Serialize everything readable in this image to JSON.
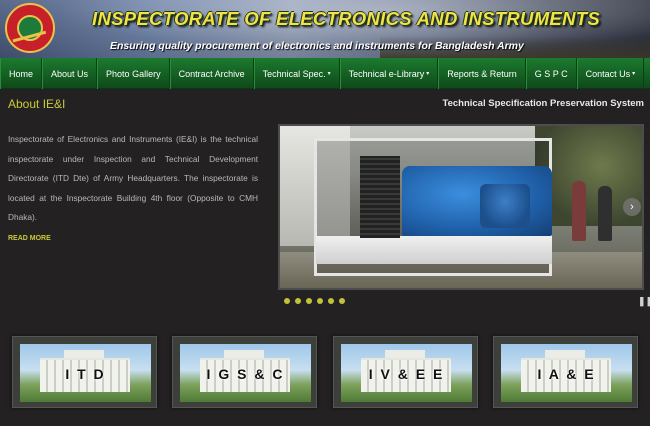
{
  "header": {
    "title": "INSPECTORATE OF ELECTRONICS AND INSTRUMENTS",
    "subtitle": "Ensuring quality procurement of electronics and instruments for Bangladesh Army",
    "logo_icon": "army-emblem-icon"
  },
  "nav": {
    "items": [
      {
        "label": "Home",
        "dropdown": false
      },
      {
        "label": "About Us",
        "dropdown": false
      },
      {
        "label": "Photo Gallery",
        "dropdown": false
      },
      {
        "label": "Contract Archive",
        "dropdown": false
      },
      {
        "label": "Technical Spec.",
        "dropdown": true
      },
      {
        "label": "Technical e-Library",
        "dropdown": true
      },
      {
        "label": "Reports & Return",
        "dropdown": false
      },
      {
        "label": "G S P C",
        "dropdown": false
      },
      {
        "label": "Contact Us",
        "dropdown": true
      }
    ],
    "caret": "▾"
  },
  "about": {
    "title": "About IE&I",
    "text": "Inspectorate of Electronics and Instruments (IE&I) is the technical inspectorate under Inspection and Technical Development Directorate (ITD Dte) of Army Headquarters. The inspectorate is located at the Inspectorate Building 4th floor (Opposite to CMH Dhaka).",
    "read_more": "READ MORE"
  },
  "slider": {
    "title": "Technical Specification Preservation System",
    "next_arrow": "›",
    "pause_icon": "❚❚",
    "dot_count": 6
  },
  "cards": [
    {
      "label": "I T D"
    },
    {
      "label": "I G S & C"
    },
    {
      "label": "I V & E E"
    },
    {
      "label": "I A & E"
    }
  ],
  "colors": {
    "accent": "#c8cb3a",
    "nav_green": "#145d22",
    "title_yellow": "#f4e04a",
    "background": "#232121"
  }
}
